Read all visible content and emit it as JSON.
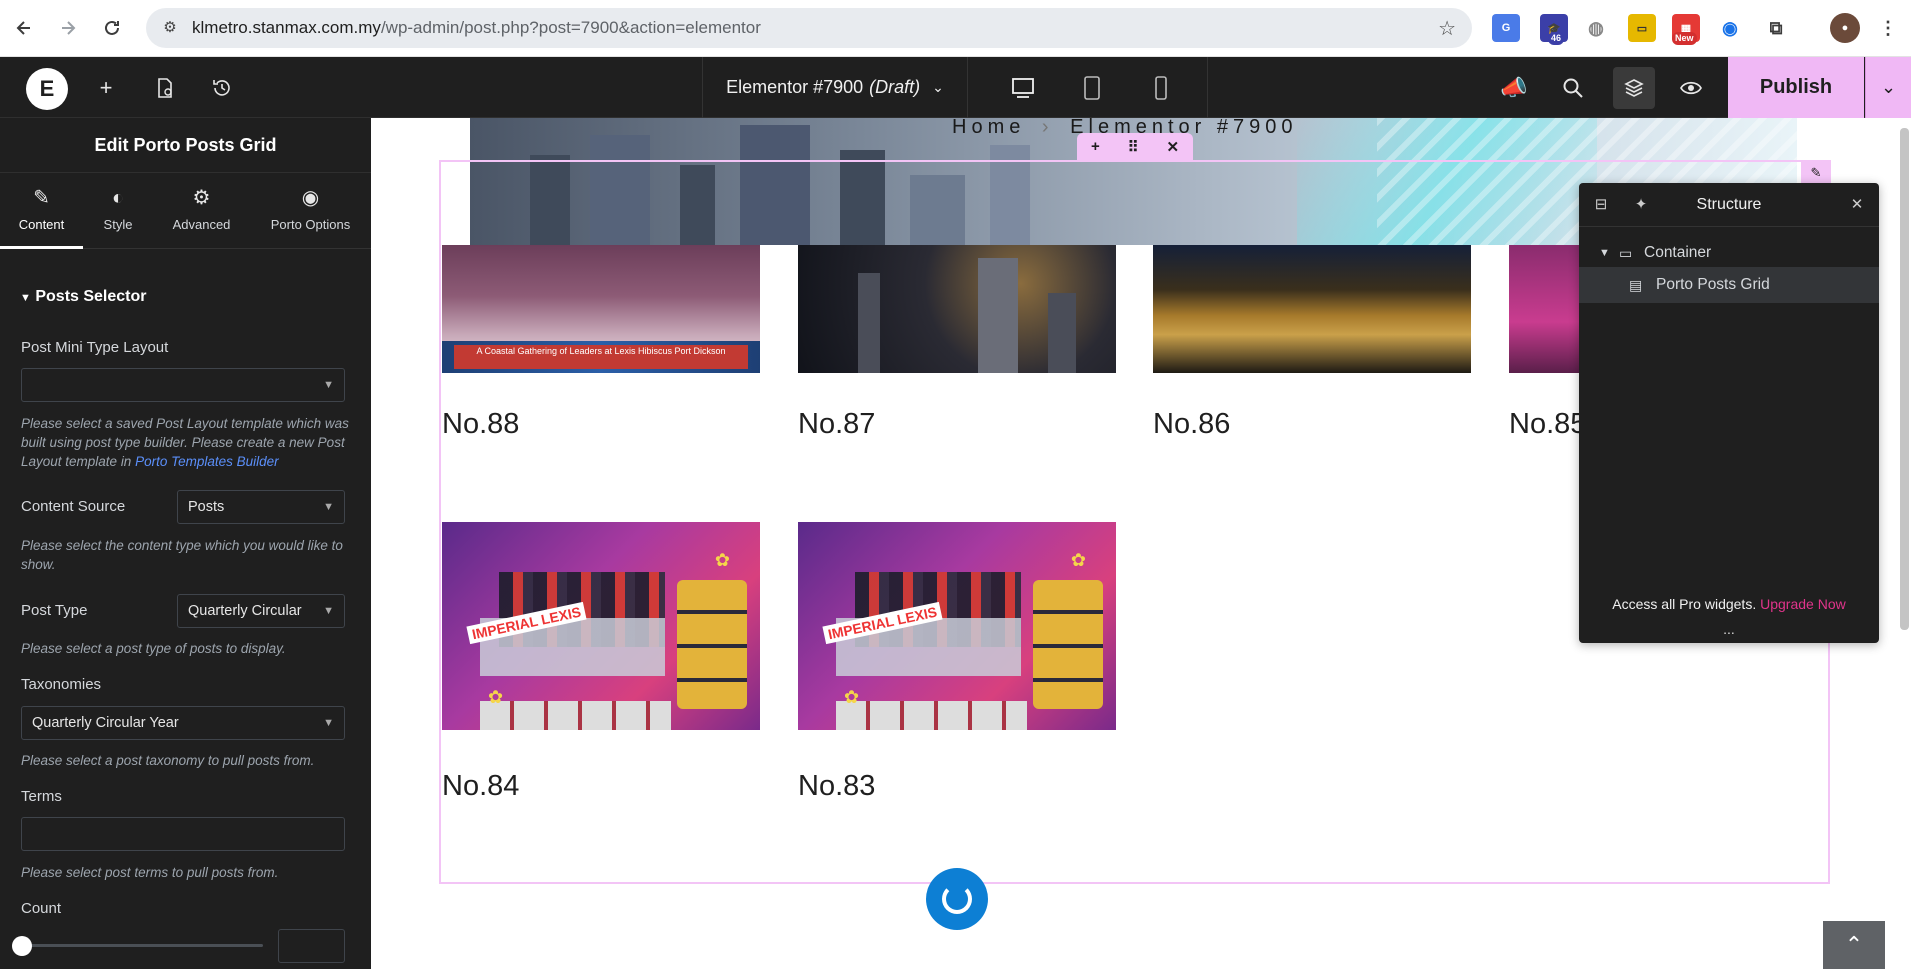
{
  "browser": {
    "url_host": "klmetro.stanmax.com.my",
    "url_path": "/wp-admin/post.php?post=7900&action=elementor",
    "ext_badge_count": "46",
    "ext_badge_new": "New"
  },
  "editor": {
    "doc_title": "Elementor #7900",
    "doc_status": "(Draft)",
    "publish_label": "Publish"
  },
  "panel": {
    "title": "Edit Porto Posts Grid",
    "tabs": [
      {
        "label": "Content"
      },
      {
        "label": "Style"
      },
      {
        "label": "Advanced"
      },
      {
        "label": "Porto Options"
      }
    ],
    "section": "Posts Selector",
    "post_mini_layout_label": "Post Mini Type Layout",
    "post_mini_layout_value": "",
    "post_mini_layout_help": "Please select a saved Post Layout template which was built using post type builder. Please create a new Post Layout template in",
    "post_mini_layout_link": "Porto Templates Builder",
    "content_source_label": "Content Source",
    "content_source_value": "Posts",
    "content_source_help": "Please select the content type which you would like to show.",
    "post_type_label": "Post Type",
    "post_type_value": "Quarterly Circular",
    "post_type_help": "Please select a post type of posts to display.",
    "taxonomies_label": "Taxonomies",
    "taxonomies_value": "Quarterly Circular Year",
    "taxonomies_help": "Please select a post taxonomy to pull posts from.",
    "terms_label": "Terms",
    "terms_help": "Please select post terms to pull posts from.",
    "count_label": "Count",
    "count_value": ""
  },
  "canvas": {
    "breadcrumb_home": "Home",
    "breadcrumb_current": "Elementor #7900",
    "posts": [
      {
        "title": "No.88",
        "banner_text": "A Coastal Gathering of Leaders at Lexis Hibiscus Port Dickson"
      },
      {
        "title": "No.87"
      },
      {
        "title": "No.86"
      },
      {
        "title": "No.85"
      },
      {
        "title": "No.84",
        "sign_text": "IMPERIAL LEXIS"
      },
      {
        "title": "No.83",
        "sign_text": "IMPERIAL LEXIS"
      }
    ]
  },
  "structure": {
    "title": "Structure",
    "items": [
      {
        "label": "Container"
      },
      {
        "label": "Porto Posts Grid"
      }
    ],
    "footer_text": "Access all Pro widgets.",
    "footer_link": "Upgrade Now",
    "more": "..."
  },
  "colors": {
    "accent_pink": "#f0b8f5",
    "upgrade_link": "#e0348b",
    "spinner_blue": "#0d7fd4"
  }
}
